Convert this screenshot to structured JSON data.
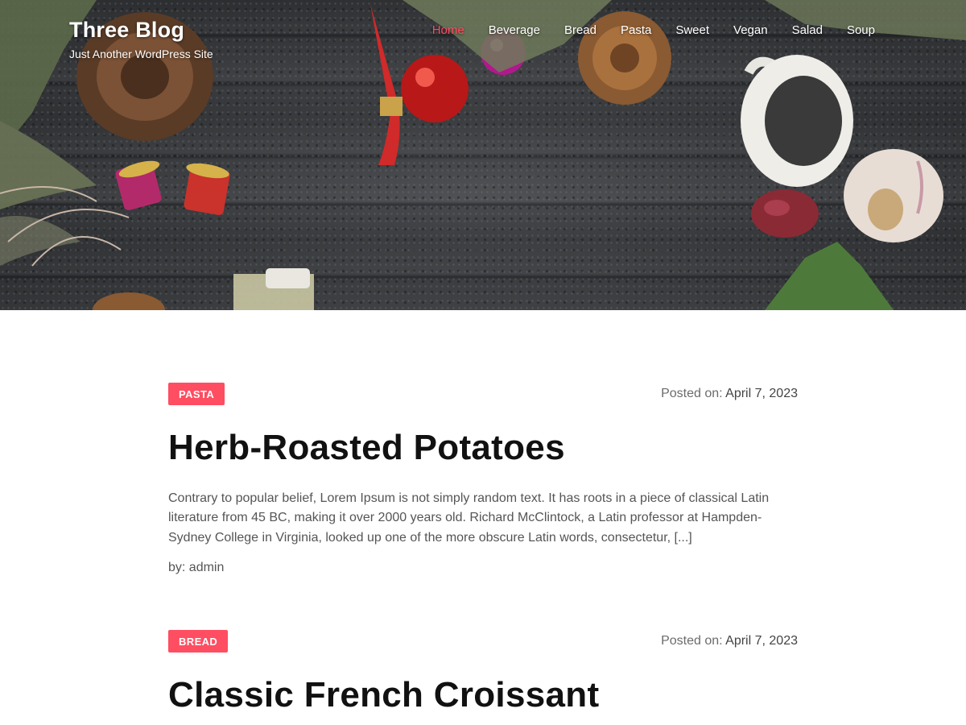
{
  "site": {
    "title": "Three Blog",
    "tagline": "Just Another WordPress Site"
  },
  "nav": {
    "items": [
      {
        "label": "Home",
        "active": true
      },
      {
        "label": "Beverage",
        "active": false
      },
      {
        "label": "Bread",
        "active": false
      },
      {
        "label": "Pasta",
        "active": false
      },
      {
        "label": "Sweet",
        "active": false
      },
      {
        "label": "Vegan",
        "active": false
      },
      {
        "label": "Salad",
        "active": false
      },
      {
        "label": "Soup",
        "active": false
      }
    ]
  },
  "posts": [
    {
      "category": "PASTA",
      "posted_prefix": "Posted on:",
      "date": "April 7, 2023",
      "title": "Herb-Roasted Potatoes",
      "excerpt": "Contrary to popular belief, Lorem Ipsum is not simply random text. It has roots in a piece of classical Latin literature from 45 BC, making it over 2000 years old. Richard McClintock, a Latin professor at Hampden-Sydney College in Virginia, looked up one of the more obscure Latin words, consectetur, [...]",
      "byline": "by: admin"
    },
    {
      "category": "BREAD",
      "posted_prefix": "Posted on:",
      "date": "April 7, 2023",
      "title": "Classic French Croissant"
    }
  ],
  "colors": {
    "accent": "#ff4d61",
    "nav_active": "#ff4a5f",
    "hero_wood": "#3b3d40"
  }
}
